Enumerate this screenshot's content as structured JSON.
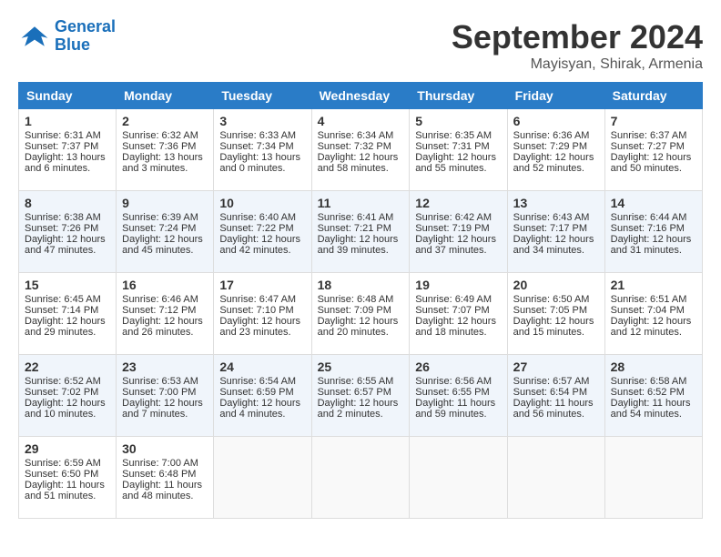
{
  "header": {
    "logo_line1": "General",
    "logo_line2": "Blue",
    "month": "September 2024",
    "location": "Mayisyan, Shirak, Armenia"
  },
  "weekdays": [
    "Sunday",
    "Monday",
    "Tuesday",
    "Wednesday",
    "Thursday",
    "Friday",
    "Saturday"
  ],
  "weeks": [
    [
      {
        "day": 1,
        "lines": [
          "Sunrise: 6:31 AM",
          "Sunset: 7:37 PM",
          "Daylight: 13 hours",
          "and 6 minutes."
        ]
      },
      {
        "day": 2,
        "lines": [
          "Sunrise: 6:32 AM",
          "Sunset: 7:36 PM",
          "Daylight: 13 hours",
          "and 3 minutes."
        ]
      },
      {
        "day": 3,
        "lines": [
          "Sunrise: 6:33 AM",
          "Sunset: 7:34 PM",
          "Daylight: 13 hours",
          "and 0 minutes."
        ]
      },
      {
        "day": 4,
        "lines": [
          "Sunrise: 6:34 AM",
          "Sunset: 7:32 PM",
          "Daylight: 12 hours",
          "and 58 minutes."
        ]
      },
      {
        "day": 5,
        "lines": [
          "Sunrise: 6:35 AM",
          "Sunset: 7:31 PM",
          "Daylight: 12 hours",
          "and 55 minutes."
        ]
      },
      {
        "day": 6,
        "lines": [
          "Sunrise: 6:36 AM",
          "Sunset: 7:29 PM",
          "Daylight: 12 hours",
          "and 52 minutes."
        ]
      },
      {
        "day": 7,
        "lines": [
          "Sunrise: 6:37 AM",
          "Sunset: 7:27 PM",
          "Daylight: 12 hours",
          "and 50 minutes."
        ]
      }
    ],
    [
      {
        "day": 8,
        "lines": [
          "Sunrise: 6:38 AM",
          "Sunset: 7:26 PM",
          "Daylight: 12 hours",
          "and 47 minutes."
        ]
      },
      {
        "day": 9,
        "lines": [
          "Sunrise: 6:39 AM",
          "Sunset: 7:24 PM",
          "Daylight: 12 hours",
          "and 45 minutes."
        ]
      },
      {
        "day": 10,
        "lines": [
          "Sunrise: 6:40 AM",
          "Sunset: 7:22 PM",
          "Daylight: 12 hours",
          "and 42 minutes."
        ]
      },
      {
        "day": 11,
        "lines": [
          "Sunrise: 6:41 AM",
          "Sunset: 7:21 PM",
          "Daylight: 12 hours",
          "and 39 minutes."
        ]
      },
      {
        "day": 12,
        "lines": [
          "Sunrise: 6:42 AM",
          "Sunset: 7:19 PM",
          "Daylight: 12 hours",
          "and 37 minutes."
        ]
      },
      {
        "day": 13,
        "lines": [
          "Sunrise: 6:43 AM",
          "Sunset: 7:17 PM",
          "Daylight: 12 hours",
          "and 34 minutes."
        ]
      },
      {
        "day": 14,
        "lines": [
          "Sunrise: 6:44 AM",
          "Sunset: 7:16 PM",
          "Daylight: 12 hours",
          "and 31 minutes."
        ]
      }
    ],
    [
      {
        "day": 15,
        "lines": [
          "Sunrise: 6:45 AM",
          "Sunset: 7:14 PM",
          "Daylight: 12 hours",
          "and 29 minutes."
        ]
      },
      {
        "day": 16,
        "lines": [
          "Sunrise: 6:46 AM",
          "Sunset: 7:12 PM",
          "Daylight: 12 hours",
          "and 26 minutes."
        ]
      },
      {
        "day": 17,
        "lines": [
          "Sunrise: 6:47 AM",
          "Sunset: 7:10 PM",
          "Daylight: 12 hours",
          "and 23 minutes."
        ]
      },
      {
        "day": 18,
        "lines": [
          "Sunrise: 6:48 AM",
          "Sunset: 7:09 PM",
          "Daylight: 12 hours",
          "and 20 minutes."
        ]
      },
      {
        "day": 19,
        "lines": [
          "Sunrise: 6:49 AM",
          "Sunset: 7:07 PM",
          "Daylight: 12 hours",
          "and 18 minutes."
        ]
      },
      {
        "day": 20,
        "lines": [
          "Sunrise: 6:50 AM",
          "Sunset: 7:05 PM",
          "Daylight: 12 hours",
          "and 15 minutes."
        ]
      },
      {
        "day": 21,
        "lines": [
          "Sunrise: 6:51 AM",
          "Sunset: 7:04 PM",
          "Daylight: 12 hours",
          "and 12 minutes."
        ]
      }
    ],
    [
      {
        "day": 22,
        "lines": [
          "Sunrise: 6:52 AM",
          "Sunset: 7:02 PM",
          "Daylight: 12 hours",
          "and 10 minutes."
        ]
      },
      {
        "day": 23,
        "lines": [
          "Sunrise: 6:53 AM",
          "Sunset: 7:00 PM",
          "Daylight: 12 hours",
          "and 7 minutes."
        ]
      },
      {
        "day": 24,
        "lines": [
          "Sunrise: 6:54 AM",
          "Sunset: 6:59 PM",
          "Daylight: 12 hours",
          "and 4 minutes."
        ]
      },
      {
        "day": 25,
        "lines": [
          "Sunrise: 6:55 AM",
          "Sunset: 6:57 PM",
          "Daylight: 12 hours",
          "and 2 minutes."
        ]
      },
      {
        "day": 26,
        "lines": [
          "Sunrise: 6:56 AM",
          "Sunset: 6:55 PM",
          "Daylight: 11 hours",
          "and 59 minutes."
        ]
      },
      {
        "day": 27,
        "lines": [
          "Sunrise: 6:57 AM",
          "Sunset: 6:54 PM",
          "Daylight: 11 hours",
          "and 56 minutes."
        ]
      },
      {
        "day": 28,
        "lines": [
          "Sunrise: 6:58 AM",
          "Sunset: 6:52 PM",
          "Daylight: 11 hours",
          "and 54 minutes."
        ]
      }
    ],
    [
      {
        "day": 29,
        "lines": [
          "Sunrise: 6:59 AM",
          "Sunset: 6:50 PM",
          "Daylight: 11 hours",
          "and 51 minutes."
        ]
      },
      {
        "day": 30,
        "lines": [
          "Sunrise: 7:00 AM",
          "Sunset: 6:48 PM",
          "Daylight: 11 hours",
          "and 48 minutes."
        ]
      },
      null,
      null,
      null,
      null,
      null
    ]
  ]
}
